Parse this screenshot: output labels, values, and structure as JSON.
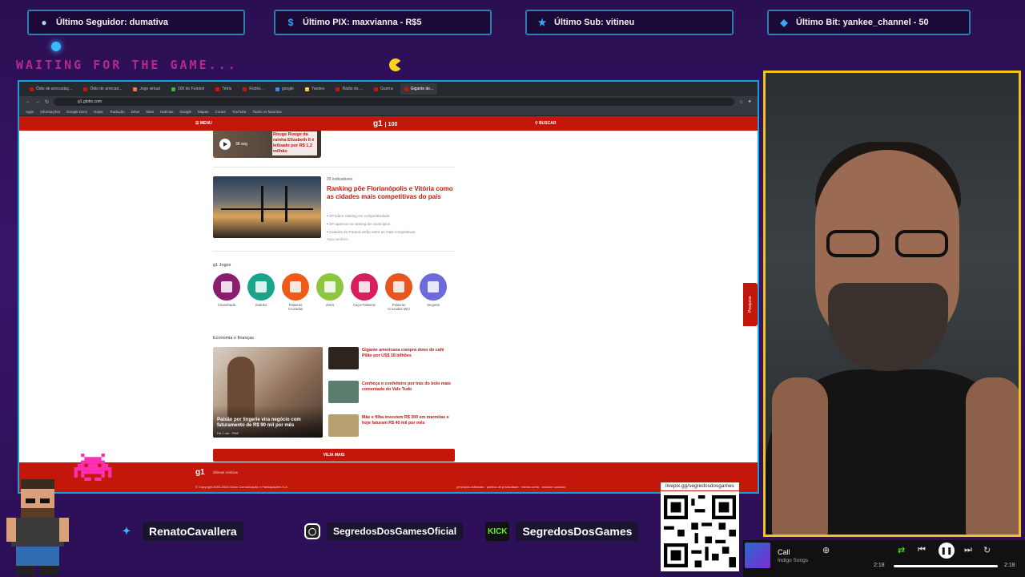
{
  "overlay": {
    "alerts": [
      {
        "icon": "user-icon",
        "text": "Último Seguidor: dumativa"
      },
      {
        "icon": "dollar-icon",
        "text": "Último PIX: maxvianna - R$5"
      },
      {
        "icon": "star-icon",
        "text": "Último Sub: vitineu"
      },
      {
        "icon": "diamond-icon",
        "text": "Último Bit: yankee_channel - 50"
      }
    ],
    "waiting": "WAITING FOR THE GAME..."
  },
  "browser": {
    "tabs": [
      "Ódio de arrecadaç...",
      "Ódio de arrecad...",
      "Jogo virtual",
      "100 do Futebol",
      "Tetris",
      "Robôs ..",
      "google",
      "Yandex",
      "Rádio do ...",
      "Guerra",
      "Gigante de..."
    ],
    "url": "g1.globo.com",
    "bookmarks": [
      "Apps",
      "Informações",
      "Google Docs",
      "Guias",
      "Tradução",
      "Drive",
      "Sites",
      "Notícias",
      "Google",
      "Mapas",
      "Cortes",
      "YouTube",
      "Todos os favoritos"
    ]
  },
  "g1": {
    "menu": "MENU",
    "logo": "g1",
    "logo_badge": "100",
    "search": "BUSCAR",
    "video": {
      "duration": "38 seg",
      "title": "Rouge Rouge da rainha Elizabeth II é leiloado por R$ 1,2 milhão"
    },
    "featured": {
      "kicker": "25 indicadores",
      "headline": "Ranking põe Florianópolis e Vitória como as cidades mais competitivas do país",
      "bullets": [
        "SP lidera ranking em competitividade",
        "SP aparece no ranking de municípios",
        "Cidades do Paraná estão entre as mais competitivas"
      ],
      "related": "Veja também"
    },
    "games_title": "g1 Jogos",
    "games": [
      {
        "name": "Caminhada",
        "color": "#8a1d6e"
      },
      {
        "name": "Sudoku",
        "color": "#19a58a"
      },
      {
        "name": "Palavras Cruzadas",
        "color": "#ef5a18"
      },
      {
        "name": "Zetra",
        "color": "#8dc63f"
      },
      {
        "name": "Caça-Palavras",
        "color": "#d91f5a"
      },
      {
        "name": "Palavras Cruzadas Mini",
        "color": "#e8551e"
      },
      {
        "name": "Sequela",
        "color": "#6d6ad9"
      }
    ],
    "economy_title": "Economia e finanças",
    "economy_main": {
      "title": "Paixão por lingerie vira negócio com faturamento de R$ 90 mil por mês",
      "meta": "Há 1 dia · PME"
    },
    "economy_items": [
      {
        "title": "Gigante americana compra dono do café Pilão por US$ 18 bilhões",
        "color": "#2e241c"
      },
      {
        "title": "Conheça o confeiteiro por trás do bolo mais comentado do Vale Tudo",
        "color": "#5a7d6e"
      },
      {
        "title": "Mãe e filha investem R$ 300 em marmitas e hoje faturam R$ 40 mil por mês",
        "color": "#b8a071"
      }
    ],
    "see_more": "VEJA MAIS",
    "footer_logo": "g1",
    "footer_text": "últimas notícias",
    "copyright": "© Copyright 2000-2025 Globo Comunicação e Participações S.A.",
    "footer_links": "princípios editoriais · política de privacidade · minha conta · anuncie conosco",
    "pesquisa": "Pesquisa"
  },
  "social": {
    "twitter": "RenatoCavallera",
    "instagram": "SegredosDosGamesOficial",
    "kick_logo": "KICK",
    "kick": "SegredosDosGames"
  },
  "qr_label": "livepix.gg/segredosdosgames",
  "player": {
    "song": "Call",
    "artist": "Indigo Songs",
    "time_elapsed": "2:18",
    "time_total": "2:18",
    "progress": 1.0
  }
}
